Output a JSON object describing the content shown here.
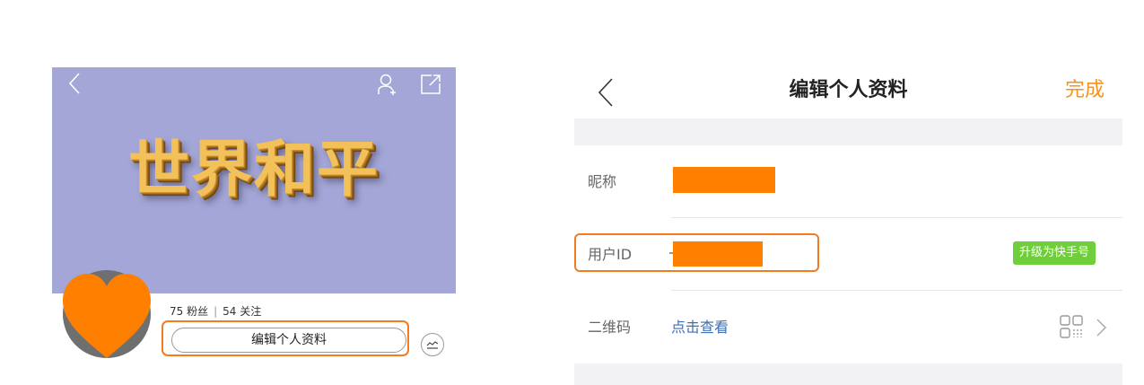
{
  "left": {
    "banner_title": "世界和平",
    "stats": {
      "fans": "75 粉丝",
      "following": "54 关注",
      "separator": "|"
    },
    "edit_profile_label": "编辑个人资料",
    "colors": {
      "banner_bg": "#a3a6d6",
      "heart": "#ff7f00",
      "highlight": "#f47b20"
    },
    "icons": [
      "back-chevron-icon",
      "add-friend-icon",
      "share-icon",
      "trend-icon",
      "heart-sticker-icon"
    ]
  },
  "right": {
    "header": {
      "title": "编辑个人资料",
      "done_label": "完成"
    },
    "rows": [
      {
        "label": "昵称"
      },
      {
        "label": "用户ID",
        "badge": "升级为快手号"
      },
      {
        "label": "二维码",
        "value": "点击查看"
      }
    ],
    "colors": {
      "done": "#f7921e",
      "badge": "#6fce3a",
      "link": "#3f6eb3",
      "redaction": "#ff7f00"
    },
    "icons": [
      "back-chevron-icon",
      "qr-code-icon",
      "chevron-right-icon"
    ]
  }
}
